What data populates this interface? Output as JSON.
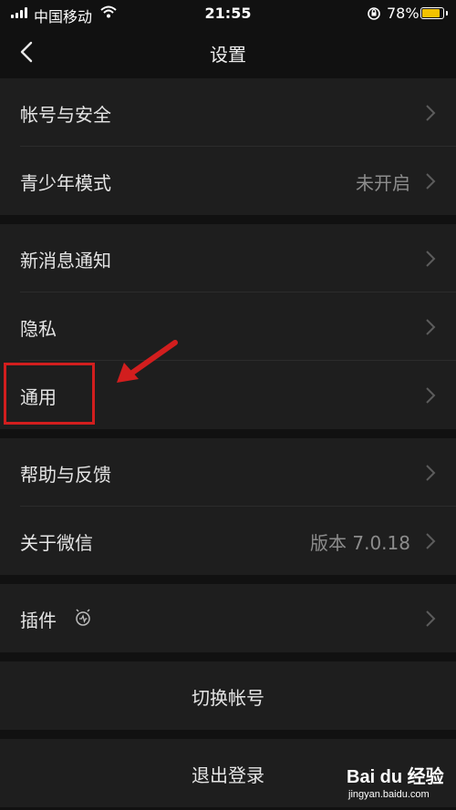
{
  "status_bar": {
    "carrier": "中国移动",
    "time": "21:55",
    "battery": "78%",
    "battery_level": 0.78
  },
  "nav": {
    "title": "设置"
  },
  "groups": [
    {
      "items": [
        {
          "label": "帐号与安全"
        },
        {
          "label": "青少年模式",
          "value": "未开启"
        }
      ]
    },
    {
      "items": [
        {
          "label": "新消息通知"
        },
        {
          "label": "隐私"
        },
        {
          "label": "通用"
        }
      ]
    },
    {
      "items": [
        {
          "label": "帮助与反馈"
        },
        {
          "label": "关于微信",
          "value": "版本 7.0.18"
        }
      ]
    },
    {
      "items": [
        {
          "label": "插件",
          "icon": "plugin-icon"
        }
      ]
    }
  ],
  "buttons": {
    "switch_account": "切换帐号",
    "logout": "退出登录"
  },
  "annotation": {
    "highlight_color": "#d21e1e"
  },
  "watermark": {
    "brand": "Bai du 经验",
    "url": "jingyan.baidu.com"
  }
}
